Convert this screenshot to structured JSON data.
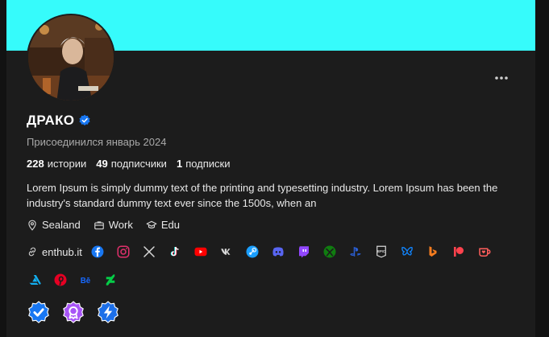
{
  "profile": {
    "name": "ДРАКО",
    "joined": "Присоединился январь 2024",
    "stats": [
      {
        "count": "228",
        "label": "истории"
      },
      {
        "count": "49",
        "label": "подписчики"
      },
      {
        "count": "1",
        "label": "подписки"
      }
    ],
    "bio": "Lorem Ipsum is simply dummy text of the printing and typesetting industry. Lorem Ipsum has been the industry's standard dummy text ever since the 1500s, when an",
    "meta": {
      "location": "Sealand",
      "work": "Work",
      "education": "Edu"
    },
    "website": "enthub.it"
  },
  "colors": {
    "banner": "#36fbfb",
    "card": "#1c1c1c",
    "verified": "#1877f2"
  },
  "icons": {
    "row1": [
      "facebook-icon",
      "instagram-icon",
      "x-icon",
      "tiktok-icon",
      "youtube-icon",
      "vk-icon",
      "steam-icon",
      "discord-icon",
      "twitch-icon",
      "xbox-icon",
      "playstation-icon",
      "epic-games-icon",
      "bluesky-icon",
      "bing-icon",
      "patreon-icon",
      "kofi-icon"
    ],
    "row2": [
      "artstation-icon",
      "pinterest-icon",
      "behance-icon",
      "deviantart-icon"
    ],
    "badges": [
      "verified-badge",
      "premium-badge",
      "boost-badge"
    ]
  }
}
